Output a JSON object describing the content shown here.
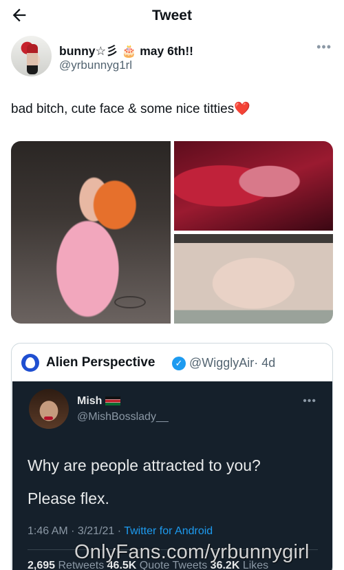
{
  "header": {
    "title": "Tweet",
    "back_icon": "arrow-left-icon"
  },
  "author": {
    "display_name": "bunny☆彡 🎂 may 6th!!",
    "handle": "@yrbunnyg1rl",
    "more_icon": "ellipsis-icon"
  },
  "tweet": {
    "text": "bad bitch, cute face & some nice titties",
    "emoji": "❤️"
  },
  "media": {
    "count": 3
  },
  "quote": {
    "name": "Alien Perspective",
    "verified": true,
    "handle": "@WigglyAir",
    "time": "· 4d",
    "embedded": {
      "name": "Mish",
      "flag": "kenya-flag-icon",
      "handle": "@MishBosslady__",
      "line1": "Why are people attracted to you?",
      "line2": "Please flex.",
      "time": "1:46 AM · 3/21/21 · ",
      "source": "Twitter for Android",
      "retweets_count": "2,695",
      "retweets_label": " Retweets ",
      "quotes_count": "46.5K",
      "quotes_label": " Quote Tweets ",
      "likes_count": "36.2K",
      "likes_label": " Likes"
    }
  },
  "watermark": "OnlyFans.com/yrbunnygirl",
  "colors": {
    "accent": "#1d9bf0",
    "dark_bg": "#15202b",
    "muted": "#536471"
  }
}
